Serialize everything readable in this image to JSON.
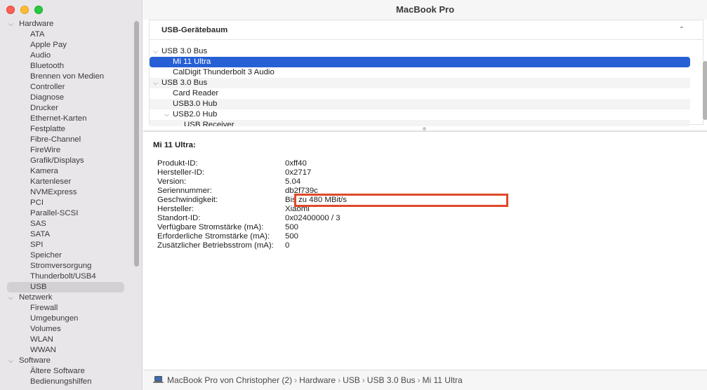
{
  "window": {
    "title": "MacBook Pro"
  },
  "sidebar": {
    "groups": [
      {
        "label": "Hardware",
        "items": [
          "ATA",
          "Apple Pay",
          "Audio",
          "Bluetooth",
          "Brennen von Medien",
          "Controller",
          "Diagnose",
          "Drucker",
          "Ethernet-Karten",
          "Festplatte",
          "Fibre-Channel",
          "FireWire",
          "Grafik/Displays",
          "Kamera",
          "Kartenleser",
          "NVMExpress",
          "PCI",
          "Parallel-SCSI",
          "SAS",
          "SATA",
          "SPI",
          "Speicher",
          "Stromversorgung",
          "Thunderbolt/USB4",
          "USB"
        ]
      },
      {
        "label": "Netzwerk",
        "items": [
          "Firewall",
          "Umgebungen",
          "Volumes",
          "WLAN",
          "WWAN"
        ]
      },
      {
        "label": "Software",
        "items": [
          "Ältere Software",
          "Bedienungshilfen"
        ]
      }
    ],
    "selected": "USB"
  },
  "tree": {
    "header": "USB-Gerätebaum",
    "rows": [
      {
        "label": "USB 3.0 Bus",
        "level": 0,
        "expanded": true
      },
      {
        "label": "Mi 11 Ultra",
        "level": 1,
        "selected": true
      },
      {
        "label": "CalDigit Thunderbolt 3 Audio",
        "level": 1
      },
      {
        "label": "USB 3.0 Bus",
        "level": 0,
        "expanded": true
      },
      {
        "label": "Card Reader",
        "level": 1
      },
      {
        "label": "USB3.0 Hub",
        "level": 1
      },
      {
        "label": "USB2.0 Hub",
        "level": 1,
        "expanded": true
      },
      {
        "label": "USB Receiver",
        "level": 2
      }
    ]
  },
  "details": {
    "title": "Mi 11 Ultra:",
    "rows": [
      {
        "key": "Produkt-ID:",
        "value": "0xff40"
      },
      {
        "key": "Hersteller-ID:",
        "value": "0x2717"
      },
      {
        "key": "Version:",
        "value": "5.04"
      },
      {
        "key": "Seriennummer:",
        "value": "db2f739c"
      },
      {
        "key": "Geschwindigkeit:",
        "value": "Bis zu 480 MBit/s",
        "highlighted": true
      },
      {
        "key": "Hersteller:",
        "value": "Xiaomi"
      },
      {
        "key": "Standort-ID:",
        "value": "0x02400000 / 3"
      },
      {
        "key": "Verfügbare Stromstärke (mA):",
        "value": "500"
      },
      {
        "key": "Erforderliche Stromstärke (mA):",
        "value": "500"
      },
      {
        "key": "Zusätzlicher Betriebsstrom (mA):",
        "value": "0"
      }
    ],
    "highlight_color": "#e0482a"
  },
  "pathbar": {
    "crumbs": [
      "MacBook Pro von Christopher (2)",
      "Hardware",
      "USB",
      "USB 3.0 Bus",
      "Mi 11 Ultra"
    ],
    "separator": "›"
  },
  "colors": {
    "selection": "#2760d4",
    "sidebar_bg": "#e8e6e8",
    "close": "#fe5f57",
    "minimize": "#febc2e",
    "maximize": "#28c840"
  },
  "icons": {
    "expanded": "chevron-down-icon",
    "collapse_panel": "chevron-up-icon",
    "computer": "laptop-icon"
  }
}
